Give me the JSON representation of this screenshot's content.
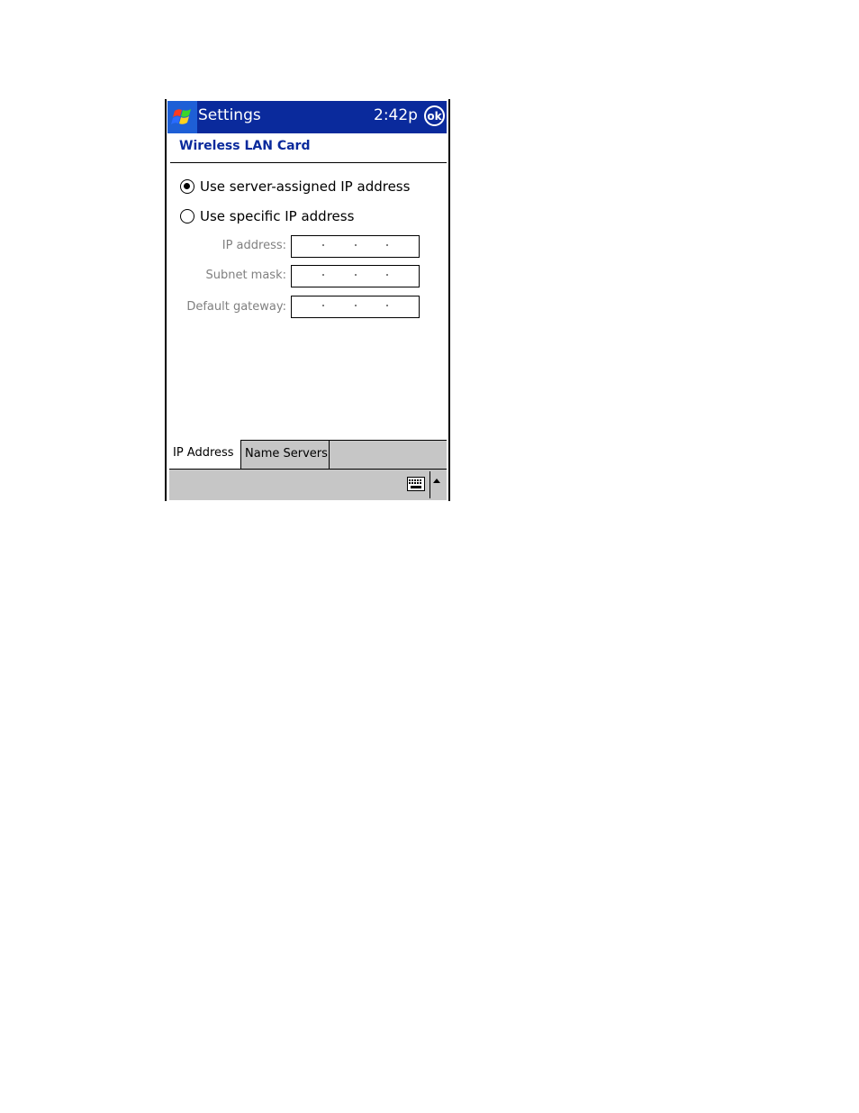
{
  "titlebar": {
    "title": "Settings",
    "time": "2:42p",
    "ok_label": "ok",
    "start_icon": "windows-flag-icon"
  },
  "section": {
    "heading": "Wireless LAN Card"
  },
  "ip_mode": {
    "options": [
      {
        "label": "Use server-assigned IP address",
        "selected": true
      },
      {
        "label": "Use specific IP address",
        "selected": false
      }
    ]
  },
  "fields": [
    {
      "label": "IP address:",
      "value": "",
      "enabled": false
    },
    {
      "label": "Subnet mask:",
      "value": "",
      "enabled": false
    },
    {
      "label": "Default gateway:",
      "value": "",
      "enabled": false
    }
  ],
  "tabs": [
    {
      "label": "IP Address",
      "active": true
    },
    {
      "label": "Name Servers",
      "active": false
    }
  ],
  "menubar": {
    "input_icon": "keyboard-icon",
    "input_menu_icon": "up-arrow-icon"
  },
  "colors": {
    "titlebar": "#0a2a9c",
    "start_button": "#1e5fd6",
    "heading": "#0a2a9c",
    "disabled_text": "#808080",
    "bar_gray": "#c6c6c6"
  }
}
